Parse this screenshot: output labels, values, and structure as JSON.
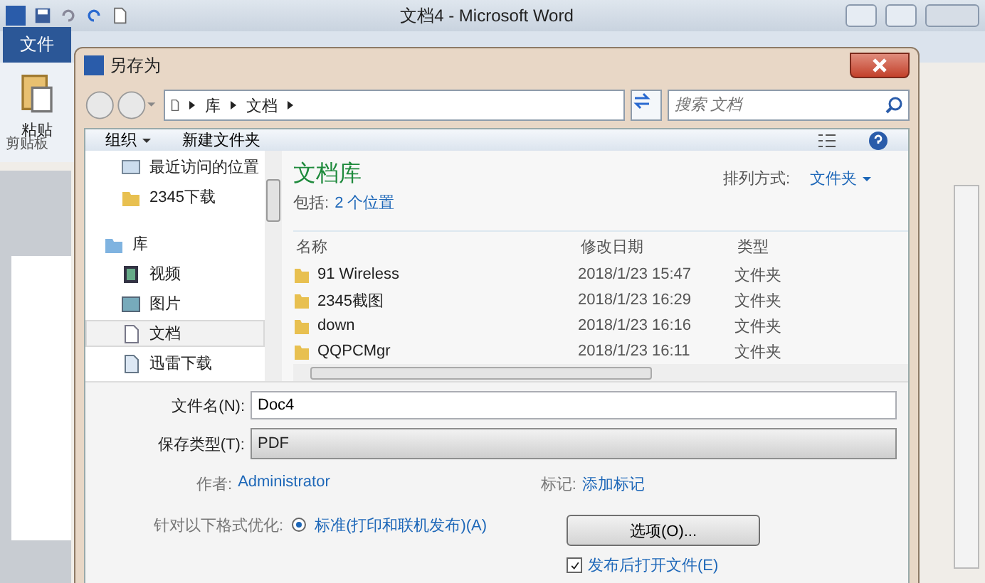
{
  "word": {
    "title": "文档4 - Microsoft Word",
    "file_tab": "文件",
    "paste": "粘贴",
    "group": "剪贴板"
  },
  "dialog": {
    "title": "另存为",
    "breadcrumb": [
      "库",
      "文档"
    ],
    "search": {
      "placeholder": "搜索 文档"
    },
    "organize": "组织",
    "new_folder": "新建文件夹",
    "nav": [
      {
        "kind": "recent",
        "label": "最近访问的位置",
        "selected": false
      },
      {
        "kind": "folder",
        "label": "2345下载",
        "selected": false
      },
      {
        "kind": "library",
        "label": "库",
        "selected": false
      },
      {
        "kind": "video",
        "label": "视频",
        "selected": false
      },
      {
        "kind": "pictures",
        "label": "图片",
        "selected": false
      },
      {
        "kind": "documents",
        "label": "文档",
        "selected": true
      },
      {
        "kind": "download",
        "label": "迅雷下载",
        "selected": false
      }
    ],
    "library": {
      "title": "文档库",
      "includes_label": "包括:",
      "includes_link": "2 个位置",
      "sort_label": "排列方式:",
      "sort_value": "文件夹"
    },
    "columns": [
      "名称",
      "修改日期",
      "类型"
    ],
    "rows": [
      {
        "name": "91 Wireless",
        "date": "2018/1/23 15:47",
        "type": "文件夹"
      },
      {
        "name": "2345截图",
        "date": "2018/1/23 16:29",
        "type": "文件夹"
      },
      {
        "name": "down",
        "date": "2018/1/23 16:16",
        "type": "文件夹"
      },
      {
        "name": "QQPCMgr",
        "date": "2018/1/23 16:11",
        "type": "文件夹"
      }
    ],
    "filename": {
      "label": "文件名(N):",
      "value": "Doc4"
    },
    "filetype": {
      "label": "保存类型(T):",
      "value": "PDF"
    },
    "author": {
      "label": "作者:",
      "value": "Administrator"
    },
    "tags": {
      "label": "标记:",
      "value": "添加标记"
    },
    "optimize": {
      "label": "针对以下格式优化:",
      "option": "标准(打印和联机发布)(A)",
      "selected": true
    },
    "options_button": "选项(O)...",
    "open_after": {
      "label": "发布后打开文件(E)",
      "checked": true
    }
  }
}
